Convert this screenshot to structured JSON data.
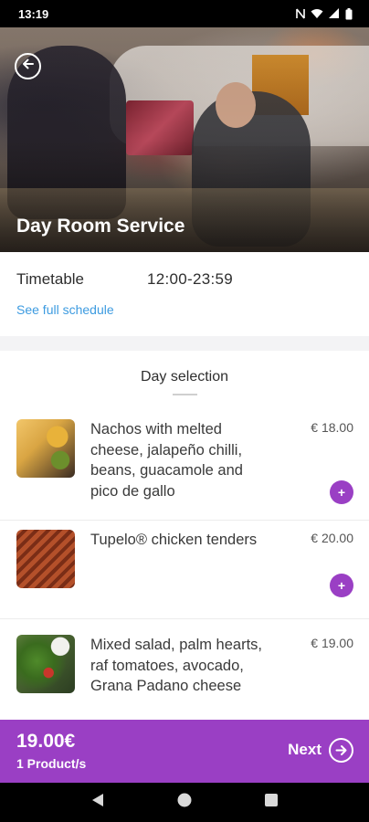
{
  "status_bar": {
    "time": "13:19",
    "icons": [
      "nfc-icon",
      "wifi-icon",
      "signal-icon",
      "battery-icon"
    ]
  },
  "hero": {
    "title": "Day Room Service",
    "back_icon": "arrow-left-circle-icon"
  },
  "timetable": {
    "label": "Timetable",
    "value": "12:00-23:59",
    "link": "See full schedule"
  },
  "section": {
    "title": "Day selection"
  },
  "menu": {
    "items": [
      {
        "name": "Nachos with melted cheese, jalapeño chilli, beans, guacamole and pico de gallo",
        "price": "€ 18.00",
        "add_label": "+",
        "thumb_icon": "nachos-image"
      },
      {
        "name": "Tupelo® chicken tenders",
        "price": "€ 20.00",
        "add_label": "+",
        "thumb_icon": "chicken-tenders-image"
      },
      {
        "name": "Mixed salad, palm hearts, raf tomatoes, avocado, Grana Padano cheese",
        "price": "€ 19.00",
        "add_label": "+",
        "thumb_icon": "salad-image"
      }
    ]
  },
  "cart": {
    "total": "19.00€",
    "count": "1 Product/s",
    "next_label": "Next",
    "next_icon": "arrow-right-circle-icon"
  },
  "nav": {
    "icons": [
      "back-triangle-icon",
      "home-circle-icon",
      "recents-square-icon"
    ]
  },
  "colors": {
    "accent": "#9a3fc4",
    "link": "#3d9be0",
    "background": "#ffffff"
  }
}
